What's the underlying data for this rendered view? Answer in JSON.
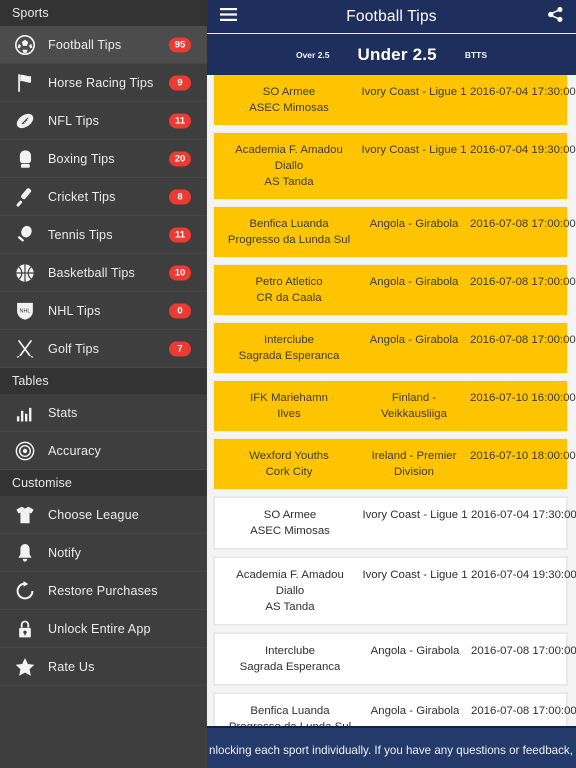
{
  "sidebar": {
    "sections": [
      {
        "title": "Sports",
        "items": [
          {
            "label": "Football Tips",
            "badge": "95",
            "icon": "football-icon",
            "active": true
          },
          {
            "label": "Horse Racing Tips",
            "badge": "9",
            "icon": "flag-icon",
            "active": false
          },
          {
            "label": "NFL Tips",
            "badge": "11",
            "icon": "american-football-icon",
            "active": false
          },
          {
            "label": "Boxing Tips",
            "badge": "20",
            "icon": "boxing-glove-icon",
            "active": false
          },
          {
            "label": "Cricket Tips",
            "badge": "8",
            "icon": "cricket-bat-icon",
            "active": false
          },
          {
            "label": "Tennis Tips",
            "badge": "11",
            "icon": "tennis-racket-icon",
            "active": false
          },
          {
            "label": "Basketball Tips",
            "badge": "10",
            "icon": "basketball-icon",
            "active": false
          },
          {
            "label": "NHL Tips",
            "badge": "0",
            "icon": "hockey-shield-icon",
            "active": false
          },
          {
            "label": "Golf Tips",
            "badge": "7",
            "icon": "golf-clubs-icon",
            "active": false
          }
        ]
      },
      {
        "title": "Tables",
        "items": [
          {
            "label": "Stats",
            "badge": "",
            "icon": "bar-chart-icon",
            "active": false
          },
          {
            "label": "Accuracy",
            "badge": "",
            "icon": "target-icon",
            "active": false
          }
        ]
      },
      {
        "title": "Customise",
        "items": [
          {
            "label": "Choose League",
            "badge": "",
            "icon": "tshirt-icon",
            "active": false
          },
          {
            "label": "Notify",
            "badge": "",
            "icon": "bell-icon",
            "active": false
          },
          {
            "label": "Restore Purchases",
            "badge": "",
            "icon": "refresh-icon",
            "active": false
          },
          {
            "label": "Unlock Entire App",
            "badge": "",
            "icon": "lock-icon",
            "active": false
          },
          {
            "label": "Rate Us",
            "badge": "",
            "icon": "star-icon",
            "active": false
          }
        ]
      }
    ]
  },
  "navbar": {
    "title": "Football Tips",
    "menu_icon": "hamburger-icon",
    "share_icon": "share-icon"
  },
  "tabs": [
    {
      "label": "Over 2.5",
      "active": false
    },
    {
      "label": "Under 2.5",
      "active": true
    },
    {
      "label": "BTTS",
      "active": false
    }
  ],
  "tips": [
    {
      "teams": "SO Armee\nASEC Mimosas",
      "league": "Ivory Coast - Ligue 1",
      "date": "2016-07-04 17:30:00",
      "highlighted": true
    },
    {
      "teams": "Academia F. Amadou Diallo\nAS Tanda",
      "league": "Ivory Coast - Ligue 1",
      "date": "2016-07-04 19:30:00",
      "highlighted": true
    },
    {
      "teams": "Benfica Luanda\nProgresso da Lunda Sul",
      "league": "Angola - Girabola",
      "date": "2016-07-08 17:00:00",
      "highlighted": true
    },
    {
      "teams": "Petro Atletico\nCR da Caala",
      "league": "Angola - Girabola",
      "date": "2016-07-08 17:00:00",
      "highlighted": true
    },
    {
      "teams": "Interclube\nSagrada Esperanca",
      "league": "Angola - Girabola",
      "date": "2016-07-08 17:00:00",
      "highlighted": true
    },
    {
      "teams": "IFK Mariehamn\nIlves",
      "league": "Finland - Veikkausliiga",
      "date": "2016-07-10 16:00:00",
      "highlighted": true
    },
    {
      "teams": "Wexford Youths\nCork City",
      "league": "Ireland - Premier Division",
      "date": "2016-07-10 18:00:00",
      "highlighted": true
    },
    {
      "teams": "SO Armee\nASEC Mimosas",
      "league": "Ivory Coast - Ligue 1",
      "date": "2016-07-04 17:30:00",
      "highlighted": false
    },
    {
      "teams": "Academia F. Amadou Diallo\nAS Tanda",
      "league": "Ivory Coast - Ligue 1",
      "date": "2016-07-04 19:30:00",
      "highlighted": false
    },
    {
      "teams": "Interclube\nSagrada Esperanca",
      "league": "Angola - Girabola",
      "date": "2016-07-08 17:00:00",
      "highlighted": false
    },
    {
      "teams": "Benfica Luanda\nProgresso da Lunda Sul",
      "league": "Angola - Girabola",
      "date": "2016-07-08 17:00:00",
      "highlighted": false
    }
  ],
  "banner": {
    "text": "nlocking each sport individually. If you have any questions or feedback, please"
  },
  "colors": {
    "navy": "#1e2f5e",
    "banner_navy": "#243a6b",
    "highlight": "#ffc400",
    "badge_red": "#ec3b33",
    "sidebar_bg": "#3e3e3e",
    "sidebar_section": "#333333",
    "sidebar_active": "#4c4c4c"
  }
}
